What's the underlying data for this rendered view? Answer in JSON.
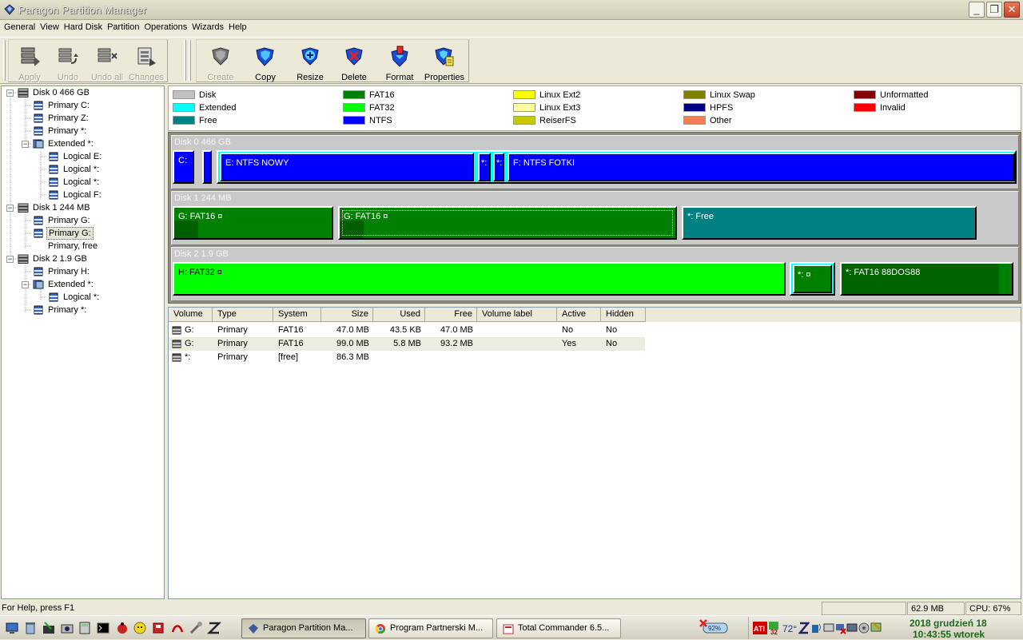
{
  "window": {
    "title": "Paragon Partition Manager"
  },
  "menu": [
    "General",
    "View",
    "Hard Disk",
    "Partition",
    "Operations",
    "Wizards",
    "Help"
  ],
  "toolbar": {
    "group1": [
      {
        "label": "Apply",
        "icon": "apply-icon",
        "enabled": false
      },
      {
        "label": "Undo",
        "icon": "undo-icon",
        "enabled": false
      },
      {
        "label": "Undo all",
        "icon": "undo-all-icon",
        "enabled": false
      },
      {
        "label": "Changes",
        "icon": "changes-icon",
        "enabled": false
      }
    ],
    "group2": [
      {
        "label": "Create",
        "icon": "create-icon",
        "enabled": false
      },
      {
        "label": "Copy",
        "icon": "copy-icon",
        "enabled": true
      },
      {
        "label": "Resize",
        "icon": "resize-icon",
        "enabled": true
      },
      {
        "label": "Delete",
        "icon": "delete-icon",
        "enabled": true
      },
      {
        "label": "Format",
        "icon": "format-icon",
        "enabled": true
      },
      {
        "label": "Properties",
        "icon": "properties-icon",
        "enabled": true
      }
    ]
  },
  "tree": [
    {
      "label": "Disk 0 466 GB",
      "level": 0,
      "type": "disk",
      "expanded": true
    },
    {
      "label": "Primary C:",
      "level": 1,
      "type": "partition"
    },
    {
      "label": "Primary Z:",
      "level": 1,
      "type": "partition"
    },
    {
      "label": "Primary *:",
      "level": 1,
      "type": "partition"
    },
    {
      "label": "Extended *:",
      "level": 1,
      "type": "extended",
      "expanded": true
    },
    {
      "label": "Logical E:",
      "level": 2,
      "type": "partition"
    },
    {
      "label": "Logical *:",
      "level": 2,
      "type": "partition"
    },
    {
      "label": "Logical *:",
      "level": 2,
      "type": "partition"
    },
    {
      "label": "Logical F:",
      "level": 2,
      "type": "partition"
    },
    {
      "label": "Disk 1 244 MB",
      "level": 0,
      "type": "disk",
      "expanded": true
    },
    {
      "label": "Primary G:",
      "level": 1,
      "type": "partition"
    },
    {
      "label": "Primary G:",
      "level": 1,
      "type": "partition",
      "selected": true
    },
    {
      "label": "Primary, free",
      "level": 1,
      "type": "free"
    },
    {
      "label": "Disk 2 1.9 GB",
      "level": 0,
      "type": "disk",
      "expanded": true
    },
    {
      "label": "Primary H:",
      "level": 1,
      "type": "partition"
    },
    {
      "label": "Extended *:",
      "level": 1,
      "type": "extended",
      "expanded": true
    },
    {
      "label": "Logical *:",
      "level": 2,
      "type": "partition"
    },
    {
      "label": "Primary *:",
      "level": 1,
      "type": "partition"
    }
  ],
  "legend": [
    {
      "label": "Disk",
      "color": "#c0c0c0"
    },
    {
      "label": "Extended",
      "color": "#00ffff"
    },
    {
      "label": "Free",
      "color": "#008080"
    },
    {
      "label": "FAT16",
      "color": "#008000"
    },
    {
      "label": "FAT32",
      "color": "#00ff00"
    },
    {
      "label": "NTFS",
      "color": "#0000ff"
    },
    {
      "label": "Linux Ext2",
      "color": "#ffff00"
    },
    {
      "label": "Linux Ext3",
      "color": "#ffff99"
    },
    {
      "label": "ReiserFS",
      "color": "#c8c800"
    },
    {
      "label": "Linux Swap",
      "color": "#808000"
    },
    {
      "label": "HPFS",
      "color": "#000080"
    },
    {
      "label": "Other",
      "color": "#f08050"
    },
    {
      "label": "Unformatted",
      "color": "#800000"
    },
    {
      "label": "Invalid",
      "color": "#ff0000"
    }
  ],
  "disks": [
    {
      "label": "Disk 0 466 GB",
      "partitions": [
        {
          "text": "C:",
          "color": "#0000ff",
          "kind": "ntfs"
        },
        {
          "text": "",
          "color": "#0000ff",
          "kind": "ntfs"
        },
        {
          "text": "E:  NTFS  NOWY",
          "color": "#0000ff",
          "kind": "ntfs-ext"
        },
        {
          "text": "*:",
          "color": "#0000ff",
          "kind": "ntfs-ext"
        },
        {
          "text": "*:",
          "color": "#0000ff",
          "kind": "ntfs-ext"
        },
        {
          "text": "F:  NTFS  FOTKI",
          "color": "#0000ff",
          "kind": "ntfs-ext"
        }
      ]
    },
    {
      "label": "Disk 1 244 MB",
      "partitions": [
        {
          "text": "G:  FAT16  ¤",
          "color": "#008000",
          "kind": "fat16"
        },
        {
          "text": "G:  FAT16  ¤",
          "color": "#008000",
          "kind": "fat16"
        },
        {
          "text": "*:  Free",
          "color": "#008080",
          "kind": "free"
        }
      ]
    },
    {
      "label": "Disk 2 1.9 GB",
      "partitions": [
        {
          "text": "H:  FAT32  ¤",
          "color": "#00ff00",
          "kind": "fat32"
        },
        {
          "text": "*:  ¤",
          "color": "#008000",
          "kind": "fat16-ext"
        },
        {
          "text": "*:  FAT16  88DOS88",
          "color": "#008000",
          "kind": "fat16"
        }
      ]
    }
  ],
  "table": {
    "columns": [
      "Volume",
      "Type",
      "System",
      "Size",
      "Used",
      "Free",
      "Volume label",
      "Active",
      "Hidden"
    ],
    "rows": [
      {
        "volume": "G:",
        "type": "Primary",
        "system": "FAT16",
        "size": "47.0 MB",
        "used": "43.5 KB",
        "free": "47.0 MB",
        "label": "",
        "active": "No",
        "hidden": "No"
      },
      {
        "volume": "G:",
        "type": "Primary",
        "system": "FAT16",
        "size": "99.0 MB",
        "used": "5.8 MB",
        "free": "93.2 MB",
        "label": "",
        "active": "Yes",
        "hidden": "No"
      },
      {
        "volume": "*:",
        "type": "Primary",
        "system": "[free]",
        "size": "86.3 MB",
        "used": "",
        "free": "",
        "label": "",
        "active": "",
        "hidden": ""
      }
    ]
  },
  "status": {
    "help": "For Help, press F1",
    "memory": "62.9 MB",
    "cpu": "CPU: 67%"
  },
  "taskbar": {
    "tasks": [
      {
        "label": "Paragon Partition Ma...",
        "active": true
      },
      {
        "label": "Program Partnerski M...",
        "active": false
      },
      {
        "label": "Total Commander 6.5...",
        "active": false
      }
    ],
    "tray": {
      "battery": "92%",
      "temp": "72°",
      "cpu_badge": "32"
    },
    "clock": {
      "date": "2018 grudzień 18",
      "time": "10:43:55 wtorek"
    }
  }
}
